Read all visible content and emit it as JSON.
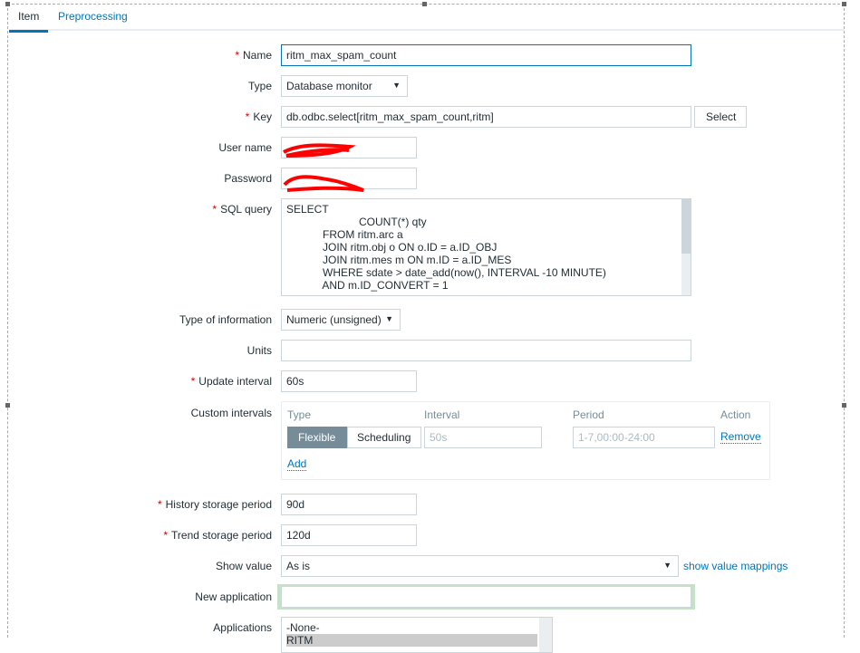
{
  "tabs": [
    {
      "label": "Item"
    },
    {
      "label": "Preprocessing"
    }
  ],
  "form": {
    "name": {
      "label": "Name",
      "value": "ritm_max_spam_count"
    },
    "type": {
      "label": "Type",
      "value": "Database monitor"
    },
    "key": {
      "label": "Key",
      "value": "db.odbc.select[ritm_max_spam_count,ritm]",
      "button": "Select"
    },
    "username": {
      "label": "User name"
    },
    "password": {
      "label": "Password"
    },
    "sql": {
      "label": "SQL query",
      "lines": [
        "SELECT",
        "                        COUNT(*) qty",
        "            FROM ritm.arc a",
        "            JOIN ritm.obj o ON o.ID = a.ID_OBJ",
        "            JOIN ritm.mes m ON m.ID = a.ID_MES",
        "            WHERE sdate > date_add(now(), INTERVAL -10 MINUTE)",
        "            AND m.ID_CONVERT = 1"
      ]
    },
    "type_info": {
      "label": "Type of information",
      "value": "Numeric (unsigned)"
    },
    "units": {
      "label": "Units",
      "value": ""
    },
    "update": {
      "label": "Update interval",
      "value": "60s"
    },
    "custom": {
      "label": "Custom intervals",
      "headers": [
        "Type",
        "Interval",
        "Period",
        "Action"
      ],
      "flexible": "Flexible",
      "scheduling": "Scheduling",
      "interval": "50s",
      "period": "1-7,00:00-24:00",
      "remove": "Remove",
      "add": "Add"
    },
    "history": {
      "label": "History storage period",
      "value": "90d"
    },
    "trend": {
      "label": "Trend storage period",
      "value": "120d"
    },
    "show_value": {
      "label": "Show value",
      "value": "As is",
      "link": "show value mappings"
    },
    "new_app": {
      "label": "New application",
      "value": ""
    },
    "applications": {
      "label": "Applications",
      "options": [
        "-None-",
        "RITM"
      ]
    }
  }
}
